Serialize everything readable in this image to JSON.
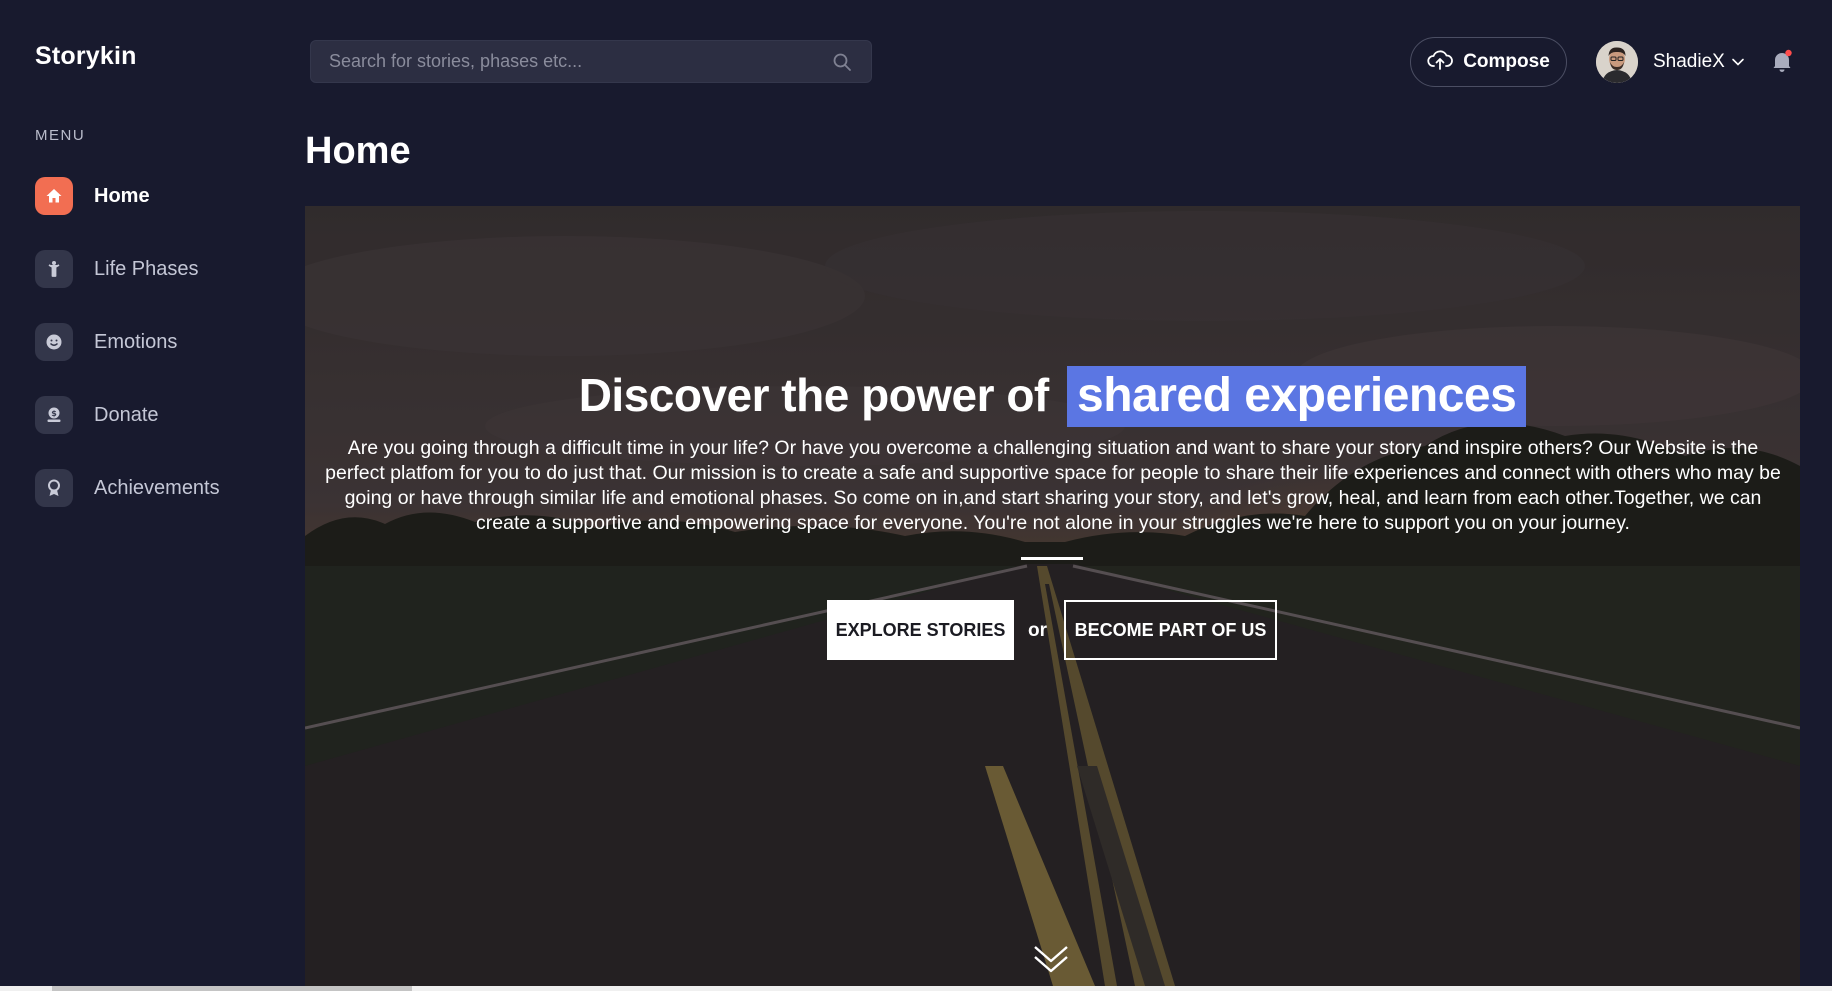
{
  "app": {
    "brand": "Storykin"
  },
  "sidebar": {
    "menu_label": "MENU",
    "items": [
      {
        "label": "Home",
        "icon": "home-icon",
        "active": true
      },
      {
        "label": "Life Phases",
        "icon": "person-icon",
        "active": false
      },
      {
        "label": "Emotions",
        "icon": "smile-icon",
        "active": false
      },
      {
        "label": "Donate",
        "icon": "money-icon",
        "active": false
      },
      {
        "label": "Achievements",
        "icon": "award-icon",
        "active": false
      }
    ]
  },
  "header": {
    "search": {
      "placeholder": "Search for stories, phases etc..."
    },
    "compose_label": "Compose",
    "user": {
      "name": "ShadieX"
    }
  },
  "page": {
    "title": "Home"
  },
  "hero": {
    "title_prefix": "Discover the power of",
    "title_highlight": "shared experiences",
    "description": "Are you going through a difficult time in your life? Or have you overcome a challenging situation and want to share your story and inspire others? Our Website is the perfect platfom for you to do just that. Our mission is to create a safe and supportive space for people to share their life experiences and connect with others who may be going or have through similar life and emotional phases. So come on in,and start sharing your story, and let's grow, heal, and learn from each other.Together, we can create a supportive and empowering space for everyone. You're not alone in your struggles we're here to support you on your journey.",
    "explore_label": "EXPLORE STORIES",
    "or_label": "or",
    "join_label": "BECOME PART OF US"
  },
  "colors": {
    "background": "#181a2e",
    "accent": "#f26e52",
    "highlight": "#5b76e3",
    "notification_dot": "#ff4d4d"
  }
}
